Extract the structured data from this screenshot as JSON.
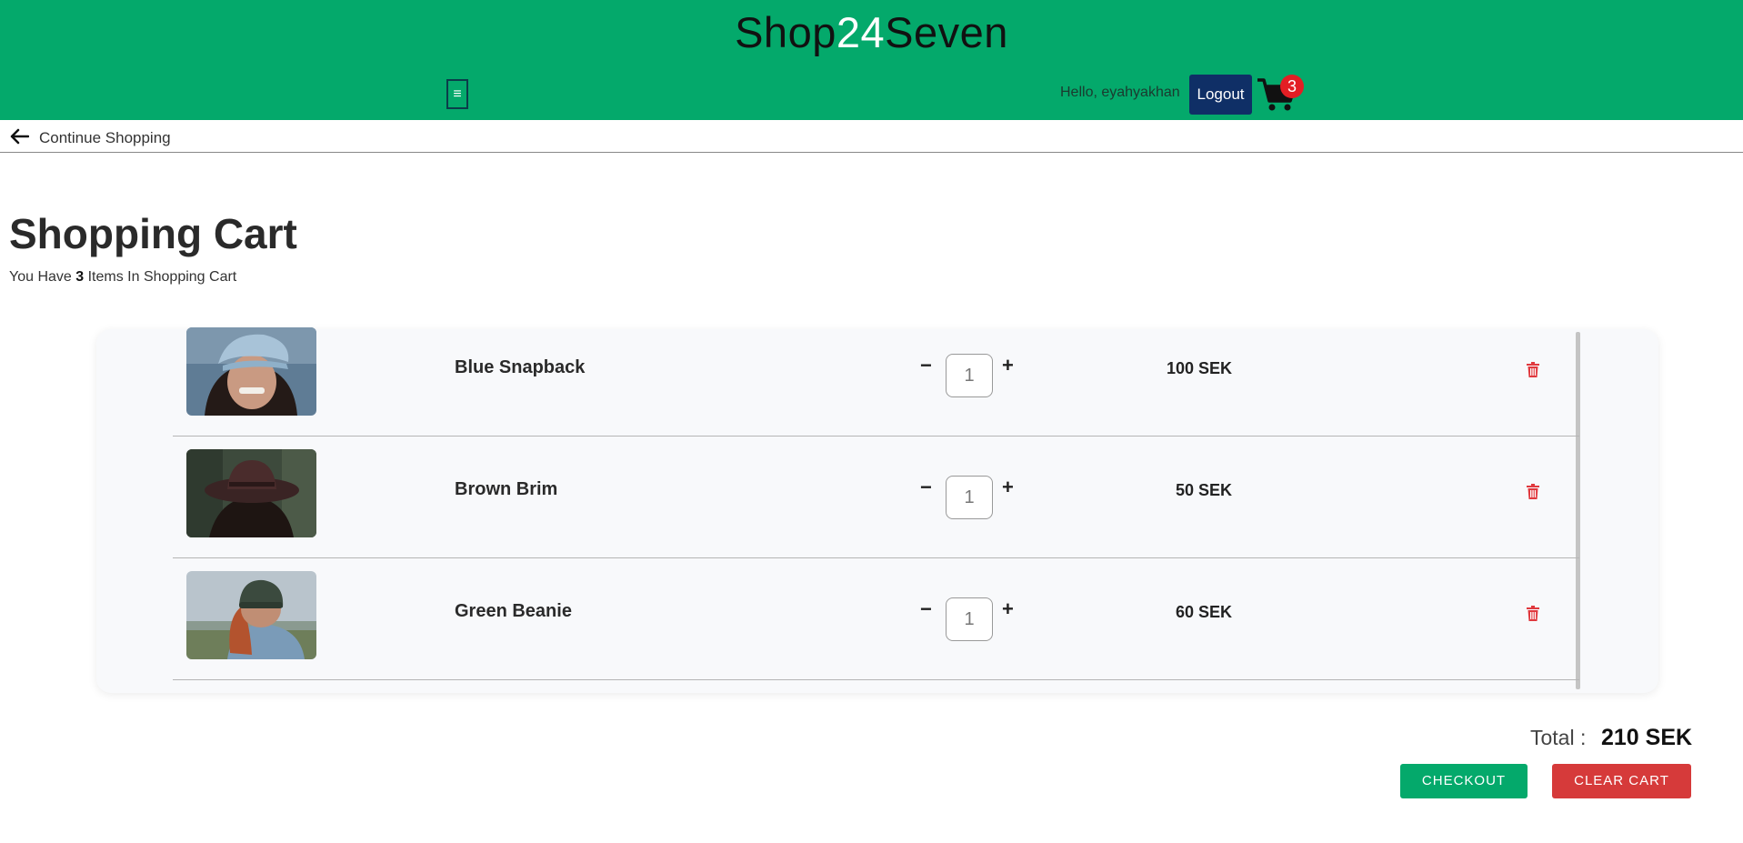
{
  "header": {
    "brand_part1": "Shop",
    "brand_part2": "24",
    "brand_part3": "Seven",
    "menu_icon": "hamburger-icon",
    "greeting": "Hello, eyahyakhan",
    "logout_label": "Logout",
    "cart_count": "3",
    "colors": {
      "header_bg": "#04a96b",
      "logout_bg": "#0f2f66",
      "badge_bg": "#e31e24"
    }
  },
  "subbar": {
    "continue_label": "Continue Shopping"
  },
  "cart": {
    "title": "Shopping Cart",
    "subtitle_prefix": "You Have ",
    "item_count": "3",
    "subtitle_suffix": " Items In Shopping Cart",
    "items": [
      {
        "name": "Blue Snapback",
        "quantity": "1",
        "price": "100 SEK",
        "minus": "−",
        "plus": "+"
      },
      {
        "name": "Brown Brim",
        "quantity": "1",
        "price": "50 SEK",
        "minus": "−",
        "plus": "+"
      },
      {
        "name": "Green Beanie",
        "quantity": "1",
        "price": "60 SEK",
        "minus": "−",
        "plus": "+"
      }
    ],
    "total_label": "Total :",
    "total_value": "210 SEK",
    "checkout_label": "CHECKOUT",
    "clear_label": "CLEAR CART",
    "colors": {
      "checkout_bg": "#04a96b",
      "clear_bg": "#d63a3a",
      "trash": "#e0393e"
    }
  }
}
